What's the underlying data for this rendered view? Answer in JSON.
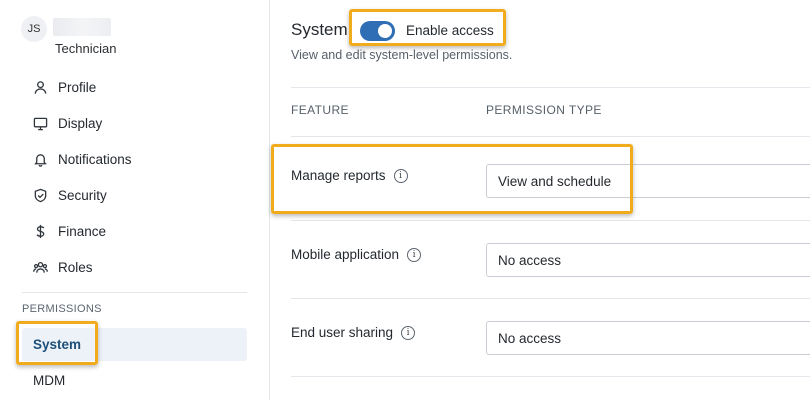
{
  "user": {
    "initials": "JS",
    "role": "Technician"
  },
  "sidebar": {
    "items": [
      {
        "label": "Profile",
        "icon": "user-icon"
      },
      {
        "label": "Display",
        "icon": "monitor-icon"
      },
      {
        "label": "Notifications",
        "icon": "bell-icon"
      },
      {
        "label": "Security",
        "icon": "shield-icon"
      },
      {
        "label": "Finance",
        "icon": "dollar-icon"
      },
      {
        "label": "Roles",
        "icon": "users-icon"
      }
    ],
    "section_label": "PERMISSIONS",
    "permission_items": [
      {
        "label": "System",
        "active": true
      },
      {
        "label": "MDM",
        "active": false
      }
    ]
  },
  "main": {
    "title": "System",
    "toggle": {
      "label": "Enable access",
      "on": true
    },
    "subtitle": "View and edit system-level permissions.",
    "columns": [
      "FEATURE",
      "PERMISSION TYPE"
    ],
    "rows": [
      {
        "feature": "Manage reports",
        "info": "i",
        "permission": "View and schedule"
      },
      {
        "feature": "Mobile application",
        "info": "i",
        "permission": "No access"
      },
      {
        "feature": "End user sharing",
        "info": "i",
        "permission": "No access"
      }
    ]
  },
  "colors": {
    "accent": "#2f6db4",
    "highlight": "#f0ac1c",
    "active_nav_bg": "#edf2f8"
  }
}
